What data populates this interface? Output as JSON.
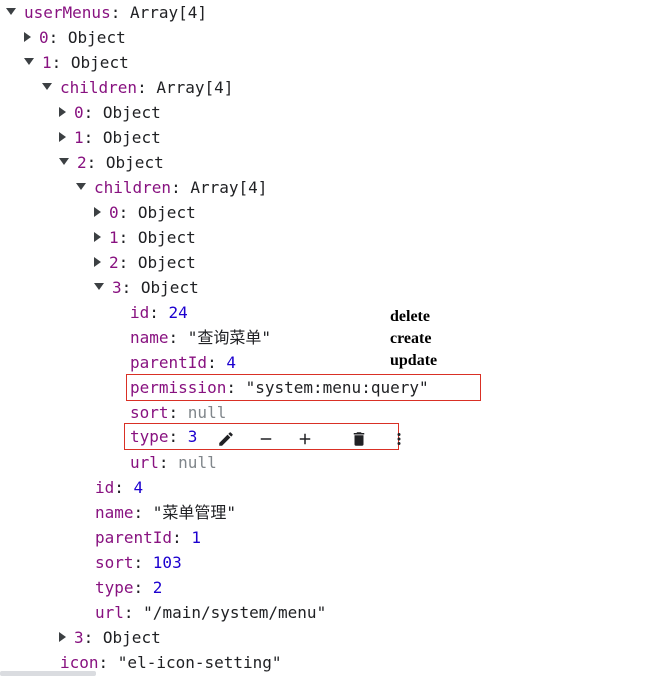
{
  "tree": {
    "root_key": "userMenus",
    "root_type": "Array[4]",
    "item0": {
      "key": "0",
      "type": "Object"
    },
    "item1": {
      "key": "1",
      "type": "Object"
    },
    "children_key": "children",
    "children_type": "Array[4]",
    "c0": {
      "key": "0",
      "type": "Object"
    },
    "c1": {
      "key": "1",
      "type": "Object"
    },
    "c2": {
      "key": "2",
      "type": "Object"
    },
    "gc_children_key": "children",
    "gc_children_type": "Array[4]",
    "g0": {
      "key": "0",
      "type": "Object"
    },
    "g1": {
      "key": "1",
      "type": "Object"
    },
    "g2": {
      "key": "2",
      "type": "Object"
    },
    "g3": {
      "key": "3",
      "type": "Object"
    },
    "g3_props": {
      "id_key": "id",
      "id_val": "24",
      "name_key": "name",
      "name_val": "\"查询菜单\"",
      "parentId_key": "parentId",
      "parentId_val": "4",
      "permission_key": "permission",
      "permission_val": "\"system:menu:query\"",
      "sort_key": "sort",
      "sort_val": "null",
      "type_key": "type",
      "type_val": "3",
      "url_key": "url",
      "url_val": "null"
    },
    "c2_props": {
      "id_key": "id",
      "id_val": "4",
      "name_key": "name",
      "name_val": "\"菜单管理\"",
      "parentId_key": "parentId",
      "parentId_val": "1",
      "sort_key": "sort",
      "sort_val": "103",
      "type_key": "type",
      "type_val": "2",
      "url_key": "url",
      "url_val": "\"/main/system/menu\""
    },
    "c3": {
      "key": "3",
      "type": "Object"
    },
    "icon_key": "icon",
    "icon_val": "\"el-icon-setting\""
  },
  "annotations": {
    "delete": "delete",
    "create": "create",
    "update": "update"
  },
  "icons": [
    "pencil-icon",
    "minus-icon",
    "plus-icon",
    "trash-icon",
    "more-vert-icon"
  ],
  "colors": {
    "highlight_border": "#d93025",
    "key": "#881280",
    "number": "#1c00cf",
    "null": "#80868b"
  }
}
